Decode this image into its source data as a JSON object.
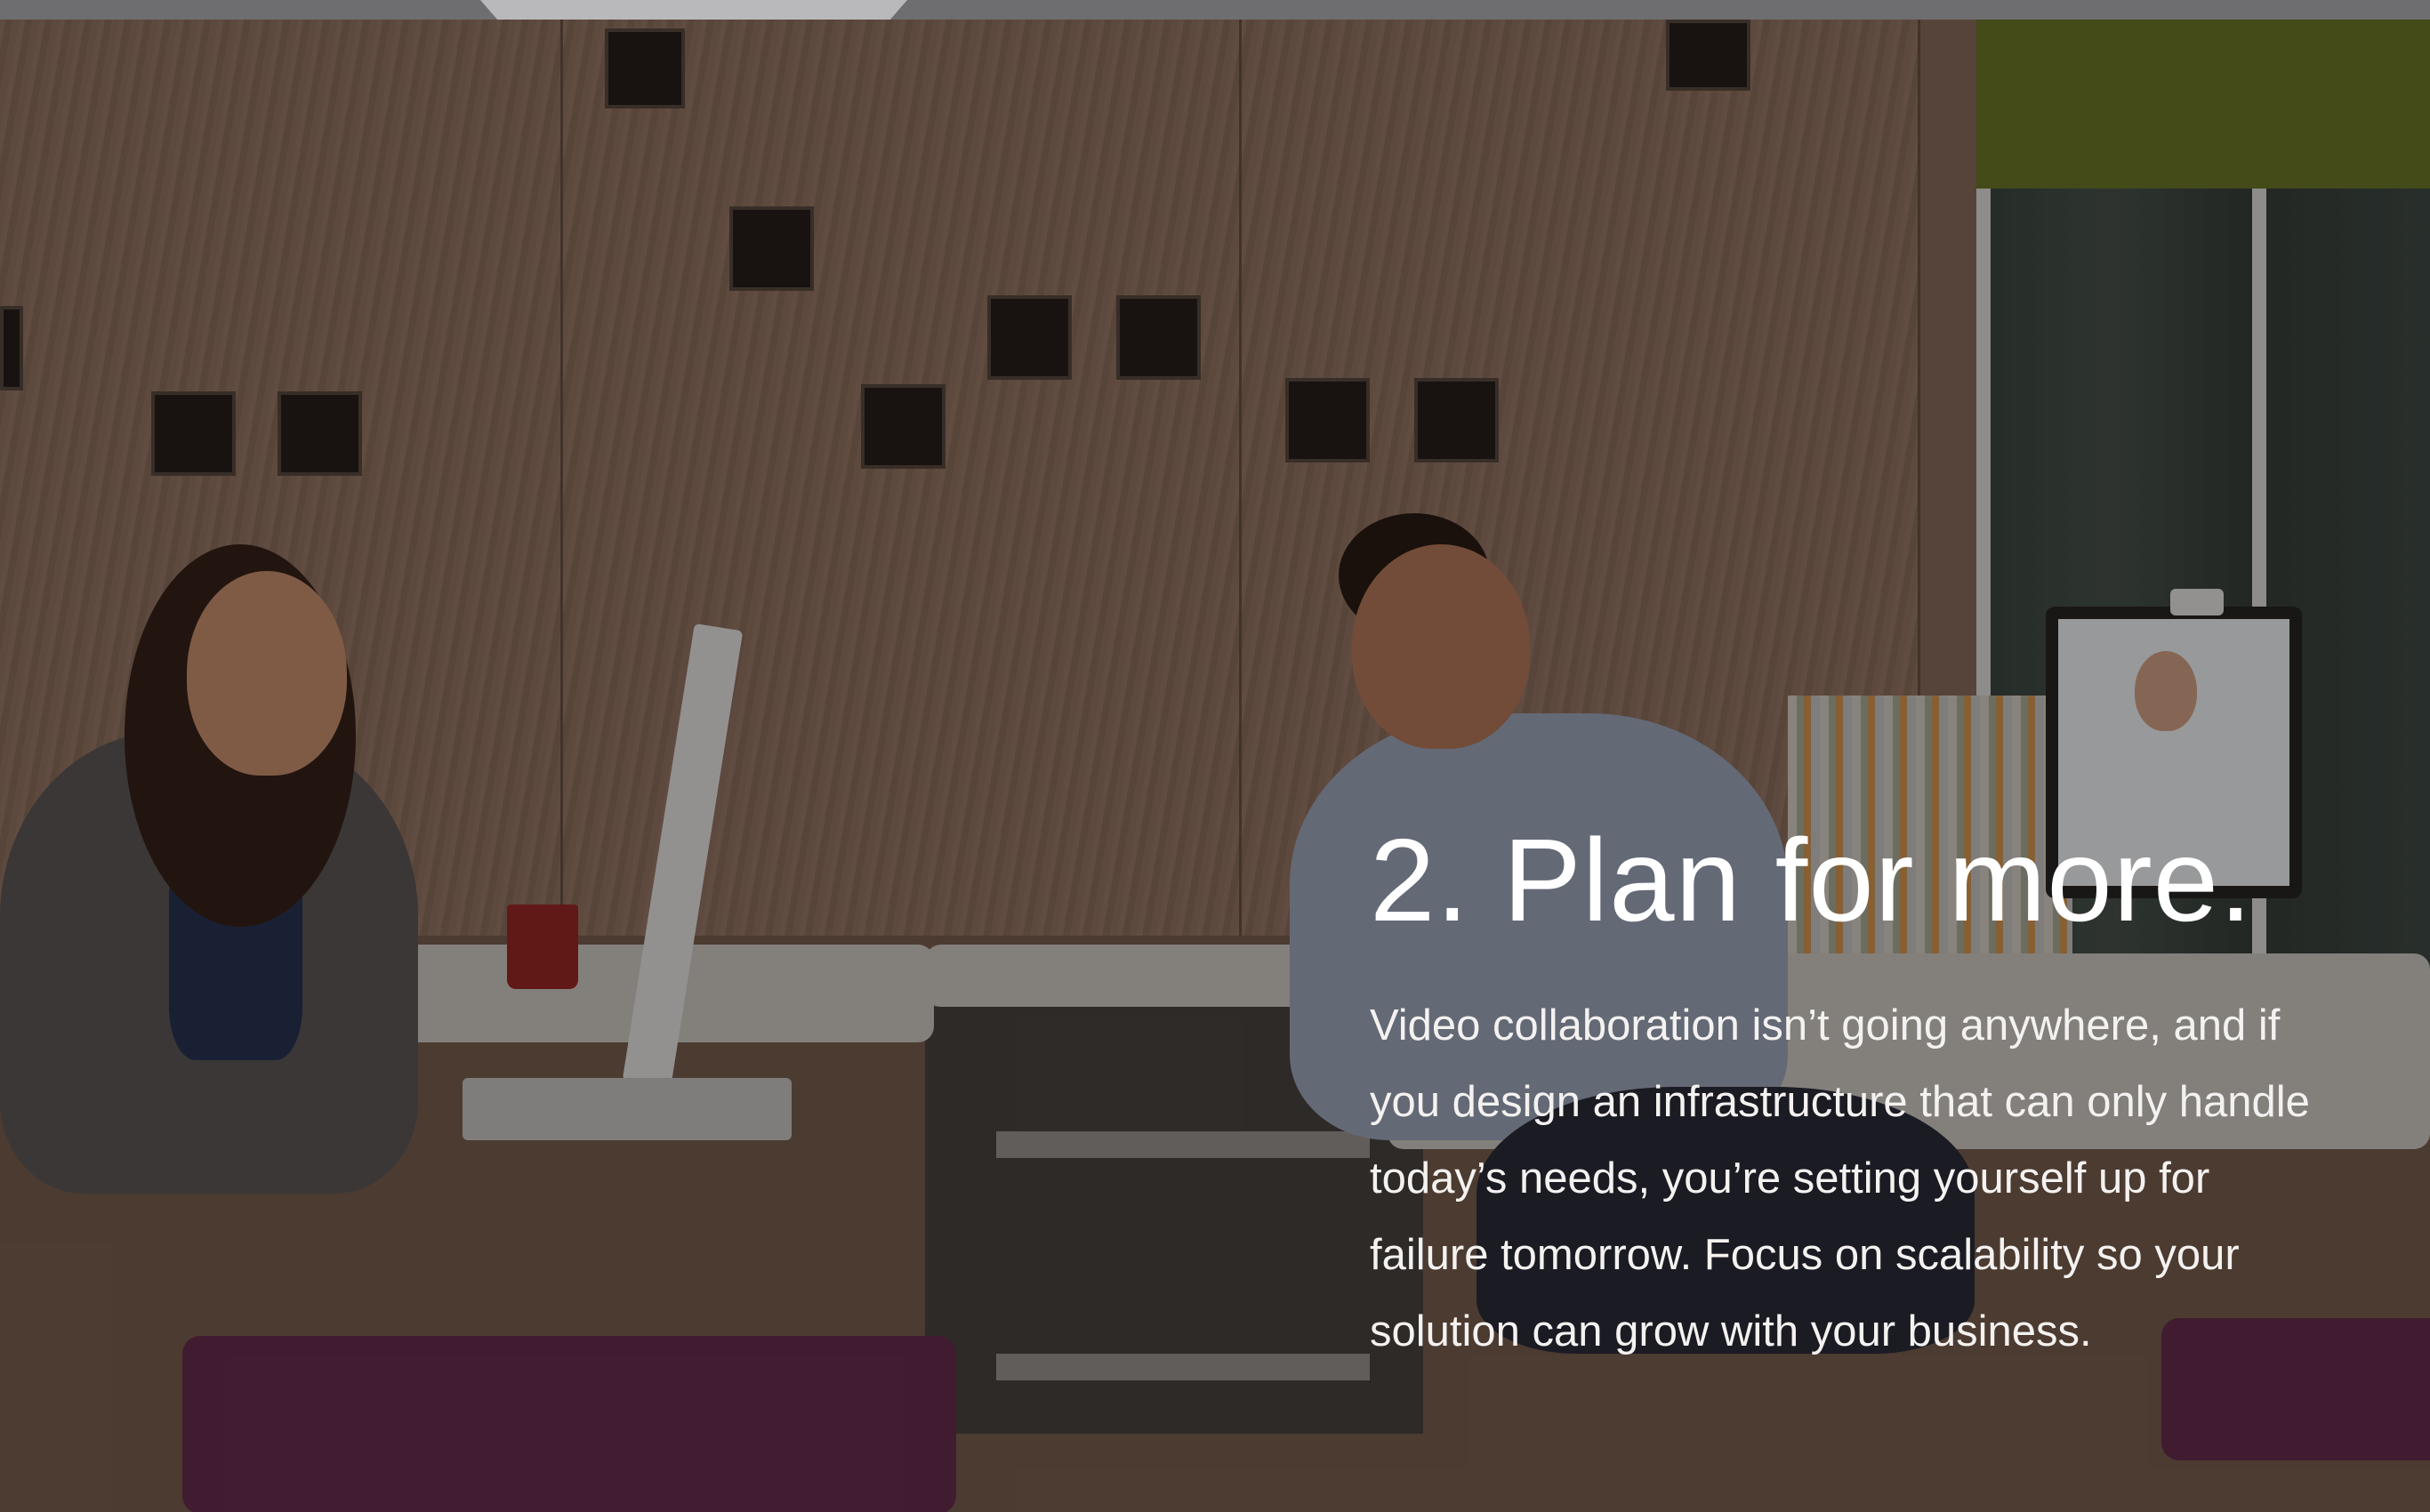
{
  "slide": {
    "heading": "2. Plan for more.",
    "body": "Video collaboration isn’t going anywhere, and if you design an infrastructure that can only handle today’s needs, you’re setting yourself up for failure tomorrow. Focus on scalability so your solution can grow with your business."
  },
  "colors": {
    "text": "#ffffff",
    "wall": "#8a6e5e",
    "seat": "#5a2446",
    "top_strip": "#6e6e70"
  }
}
